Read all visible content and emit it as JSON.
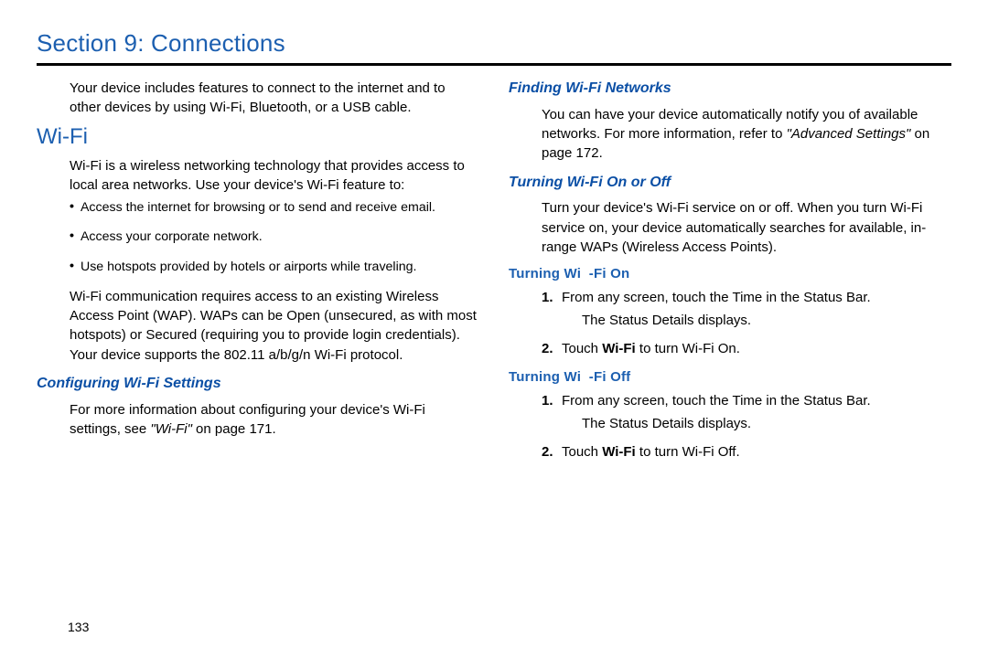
{
  "section_title": "Section 9: Connections",
  "left": {
    "intro": "Your device includes features to connect to the internet and to other devices by using Wi-Fi, Bluetooth, or a USB cable.",
    "h2": "Wi-Fi",
    "p1": "Wi-Fi is a wireless networking technology that provides access to local area networks. Use your device's Wi-Fi feature to:",
    "bullets": [
      "Access the internet for browsing or to send and receive email.",
      "Access your corporate network.",
      "Use hotspots provided by hotels or airports while traveling."
    ],
    "p2": "Wi-Fi communication requires access to an existing Wireless Access Point (WAP). WAPs can be Open (unsecured, as with most hotspots) or Secured (requiring you to provide login credentials). Your device supports the 802.11 a/b/g/n Wi-Fi protocol.",
    "h3": "Configuring Wi-Fi Settings",
    "p3a": "For more information about configuring your device's Wi-Fi settings, see ",
    "p3ref": "\"Wi-Fi\"",
    "p3b": " on page 171."
  },
  "right": {
    "h3a": "Finding Wi-Fi Networks",
    "p1a": "You can have your device automatically notify you of available networks. For more information, refer to ",
    "p1ref": "\"Advanced Settings\"",
    "p1b": "  on page 172.",
    "h3b": "Turning Wi-Fi On or Off",
    "p2": "Turn your device's Wi-Fi service on or off. When you turn Wi-Fi service on, your device automatically searches for available, in-range WAPs (Wireless Access Points).",
    "h4a": "Turning Wi  -Fi On",
    "on_steps": [
      {
        "num": "1.",
        "text_a": "From any screen, touch the Time in the Status Bar.",
        "sub": "The Status Details displays."
      },
      {
        "num": "2.",
        "text_a": "Touch ",
        "bold": "Wi-Fi",
        "text_b": " to turn Wi-Fi On."
      }
    ],
    "h4b": "Turning Wi  -Fi Off",
    "off_steps": [
      {
        "num": "1.",
        "text_a": "From any screen, touch the Time in the Status Bar.",
        "sub": "The Status Details displays."
      },
      {
        "num": "2.",
        "text_a": "Touch ",
        "bold": "Wi-Fi",
        "text_b": " to turn Wi-Fi Off."
      }
    ]
  },
  "page_num": "133"
}
